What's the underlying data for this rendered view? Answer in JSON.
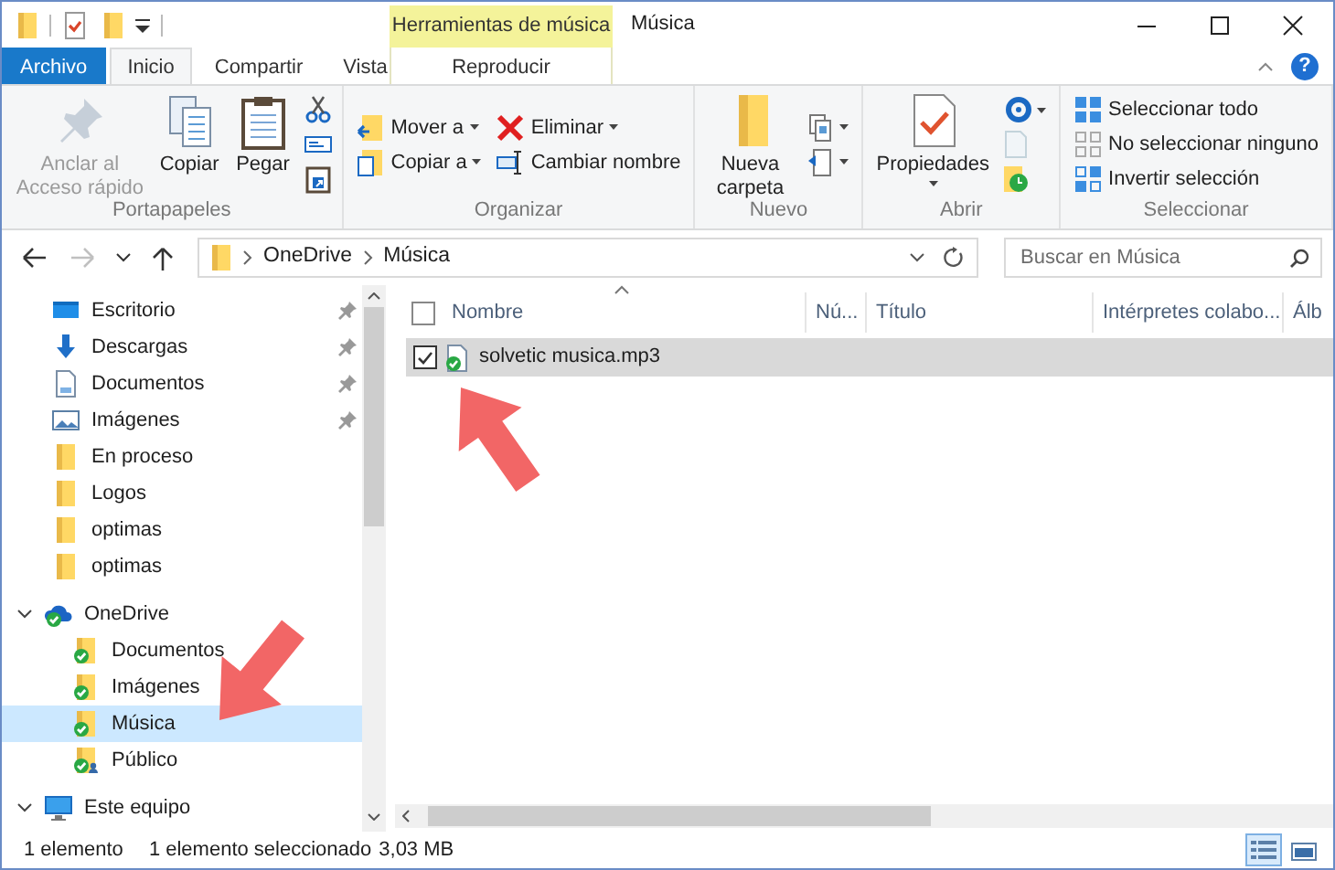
{
  "window": {
    "title": "Música",
    "context_group": "Herramientas de música",
    "help": "?"
  },
  "tabs": [
    {
      "label": "Archivo",
      "kind": "file",
      "selected": false
    },
    {
      "label": "Inicio",
      "kind": "tab",
      "selected": true
    },
    {
      "label": "Compartir",
      "kind": "tab",
      "selected": false
    },
    {
      "label": "Vista",
      "kind": "tab",
      "selected": false
    },
    {
      "label": "Reproducir",
      "kind": "context",
      "selected": false
    }
  ],
  "ribbon": {
    "groups": [
      {
        "label": "Portapapeles",
        "columns": [
          [
            {
              "kind": "large",
              "label": "Anclar al Acceso rápido",
              "disabled": true,
              "dropdown": false
            }
          ],
          [
            {
              "kind": "large",
              "label": "Copiar",
              "disabled": false,
              "dropdown": false
            }
          ],
          [
            {
              "kind": "large",
              "label": "Pegar",
              "disabled": false,
              "dropdown": false
            }
          ],
          [
            {
              "kind": "icon",
              "disabled": false,
              "dropdown": false
            },
            {
              "kind": "icon",
              "disabled": false,
              "dropdown": false
            },
            {
              "kind": "icon",
              "disabled": false,
              "dropdown": false
            }
          ]
        ]
      },
      {
        "label": "Organizar",
        "columns": [
          [
            {
              "kind": "small",
              "label": "Mover a",
              "disabled": false,
              "dropdown": true
            },
            {
              "kind": "small",
              "label": "Copiar a",
              "disabled": false,
              "dropdown": true
            }
          ],
          [
            {
              "kind": "small",
              "label": "Eliminar",
              "disabled": false,
              "dropdown": true
            },
            {
              "kind": "small",
              "label": "Cambiar nombre",
              "disabled": false,
              "dropdown": false
            }
          ]
        ]
      },
      {
        "label": "Nuevo",
        "columns": [
          [
            {
              "kind": "large",
              "label": "Nueva carpeta",
              "disabled": false,
              "dropdown": false
            }
          ],
          [
            {
              "kind": "icon",
              "disabled": false,
              "dropdown": true
            },
            {
              "kind": "icon",
              "disabled": false,
              "dropdown": true
            }
          ]
        ]
      },
      {
        "label": "Abrir",
        "columns": [
          [
            {
              "kind": "large",
              "label": "Propiedades",
              "disabled": false,
              "dropdown": true
            }
          ],
          [
            {
              "kind": "icon",
              "disabled": false,
              "dropdown": true
            },
            {
              "kind": "icon",
              "disabled": true,
              "dropdown": false
            },
            {
              "kind": "icon",
              "disabled": false,
              "dropdown": false
            }
          ]
        ]
      },
      {
        "label": "Seleccionar",
        "columns": [
          [
            {
              "kind": "small",
              "label": "Seleccionar todo",
              "disabled": false,
              "dropdown": false
            },
            {
              "kind": "small",
              "label": "No seleccionar ninguno",
              "disabled": false,
              "dropdown": false
            },
            {
              "kind": "small",
              "label": "Invertir selección",
              "disabled": false,
              "dropdown": false
            }
          ]
        ]
      }
    ]
  },
  "navigation": [
    {
      "kind": "back",
      "disabled": false
    },
    {
      "kind": "forward",
      "disabled": true
    },
    {
      "kind": "recent",
      "disabled": false
    },
    {
      "kind": "up",
      "disabled": false
    }
  ],
  "address": {
    "segments": [
      "OneDrive",
      "Música"
    ],
    "search_placeholder": "Buscar en Música"
  },
  "nav_pane": {
    "items": [
      {
        "label": "Escritorio",
        "kind": "desktop",
        "pinned": true,
        "selected": false
      },
      {
        "label": "Descargas",
        "kind": "downloads",
        "pinned": true,
        "selected": false
      },
      {
        "label": "Documentos",
        "kind": "documents",
        "pinned": true,
        "selected": false
      },
      {
        "label": "Imágenes",
        "kind": "pictures",
        "pinned": true,
        "selected": false
      },
      {
        "label": "En proceso",
        "kind": "folder",
        "pinned": false,
        "selected": false
      },
      {
        "label": "Logos",
        "kind": "folder",
        "pinned": false,
        "selected": false
      },
      {
        "label": "optimas",
        "kind": "folder",
        "pinned": false,
        "selected": false
      },
      {
        "label": "optimas",
        "kind": "folder",
        "pinned": false,
        "selected": false
      },
      {
        "label": "OneDrive",
        "kind": "cloud",
        "expanded": true,
        "selected": false,
        "children": [
          {
            "label": "Documentos",
            "kind": "synced-folder",
            "selected": false
          },
          {
            "label": "Imágenes",
            "kind": "synced-folder",
            "selected": false
          },
          {
            "label": "Música",
            "kind": "synced-folder",
            "selected": true
          },
          {
            "label": "Público",
            "kind": "shared-folder",
            "selected": false
          }
        ]
      },
      {
        "label": "Este equipo",
        "kind": "computer",
        "expanded": true,
        "selected": false
      }
    ]
  },
  "file_list": {
    "select_all_checked": false,
    "columns": [
      {
        "label": "Nombre",
        "sorted": true
      },
      {
        "label": "Nú...",
        "sorted": false
      },
      {
        "label": "Título",
        "sorted": false
      },
      {
        "label": "Intérpretes colabo...",
        "sorted": false
      },
      {
        "label": "Álb",
        "sorted": false
      }
    ],
    "rows": [
      {
        "name": "solvetic musica.mp3",
        "checked": true,
        "selected": true
      }
    ]
  },
  "status_bar": {
    "item_count": "1 elemento",
    "selection": "1 elemento seleccionado",
    "size": "3,03 MB"
  },
  "view_buttons": [
    {
      "kind": "details",
      "selected": true
    },
    {
      "kind": "large-icons",
      "selected": false
    }
  ]
}
